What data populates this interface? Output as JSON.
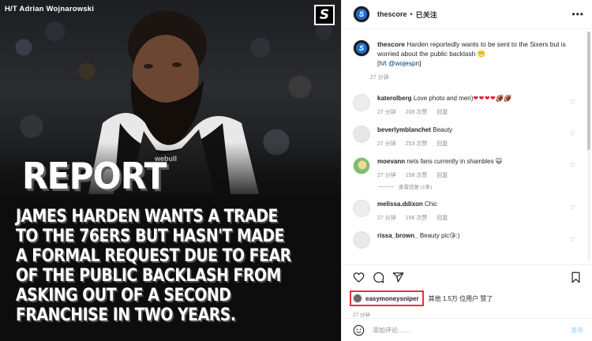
{
  "image": {
    "credit": "H/T Adrian Wojnarowski",
    "brand_letter": "S",
    "report_label": "REPORT",
    "headline": "JAMES HARDEN WANTS A TRADE TO THE 76ERS BUT HASN'T MADE A FORMAL REQUEST DUE TO FEAR OF THE PUBLIC BACKLASH FROM ASKING OUT OF A SECOND FRANCHISE IN TWO YEARS.",
    "jersey_text": "webull"
  },
  "header": {
    "username": "thescore",
    "separator": "•",
    "follow_status": "已关注",
    "more_label": "•••"
  },
  "caption": {
    "username": "thescore",
    "text": "Harden reportedly wants to be sent to the Sixers but is worried about the public backlash 😬",
    "ht": "[h/t @wojespn]",
    "time": "27 分钟"
  },
  "comments": [
    {
      "user": "katerolberg",
      "text": "Love photo and men)",
      "hearts": "❤❤❤❤",
      "balls": "🏈🏈",
      "time": "27 分钟",
      "likes": "208 次赞",
      "reply": "回复"
    },
    {
      "user": "beverlymblanchet",
      "text": "Beauty",
      "time": "27 分钟",
      "likes": "253 次赞",
      "reply": "回复"
    },
    {
      "user": "moevann",
      "text": "nets fans currently in shambles 🙀",
      "time": "27 分钟",
      "likes": "158 次赞",
      "reply": "回复",
      "view_replies": "查看回复 (1条)"
    },
    {
      "user": "melissa.ddixon",
      "text": "Chic",
      "time": "27 分钟",
      "likes": "156 次赞",
      "reply": "回复"
    },
    {
      "user": "rissa_brown_",
      "text": "Beauty pic😘:)",
      "time": "",
      "likes": "",
      "reply": ""
    }
  ],
  "likes": {
    "liker": "easymoneysniper",
    "rest": "其他 1.5万 位用户 赞了"
  },
  "post_time": "27 分钟",
  "add_comment": {
    "placeholder": "添加评论……",
    "post_label": "发布"
  },
  "colors": {
    "link": "#00376b",
    "highlight_box": "#e3343a",
    "post_button": "#b3dbff",
    "meta_gray": "#8e8e8e"
  }
}
